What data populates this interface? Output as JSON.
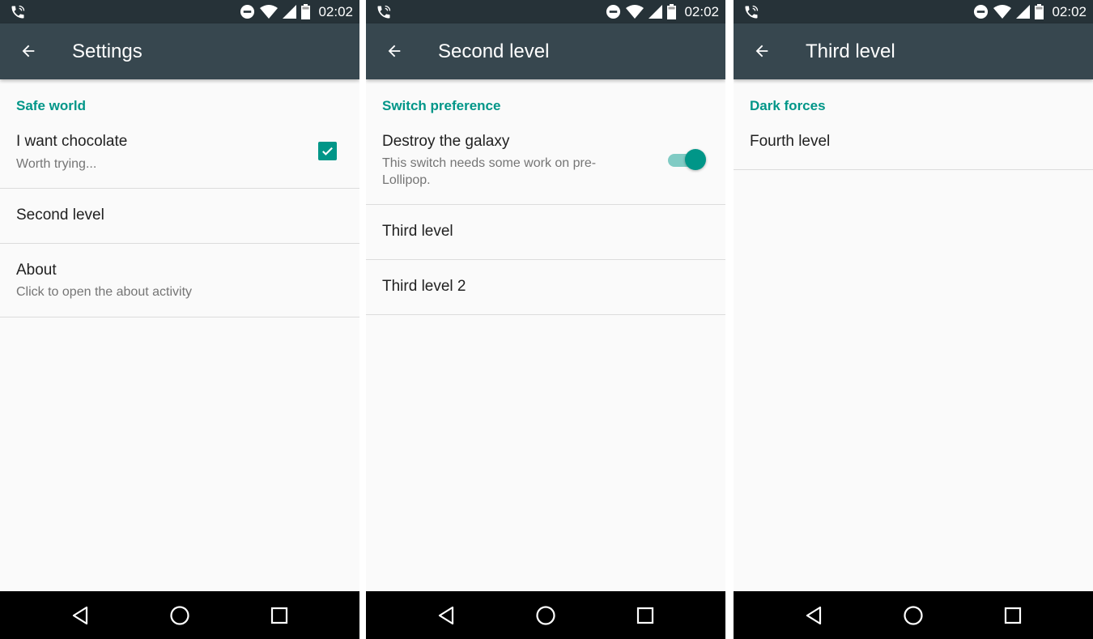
{
  "status_bar": {
    "time": "02:02",
    "icons": [
      "phone-call-icon",
      "do-not-disturb-icon",
      "wifi-icon",
      "cell-signal-icon",
      "battery-icon"
    ]
  },
  "screens": [
    {
      "title": "Settings",
      "category": "Safe world",
      "items": [
        {
          "title": "I want chocolate",
          "summary": "Worth trying...",
          "widget": "checkbox",
          "checked": true
        },
        {
          "title": "Second level"
        },
        {
          "title": "About",
          "summary": "Click to open the about activity"
        }
      ]
    },
    {
      "title": "Second level",
      "category": "Switch preference",
      "items": [
        {
          "title": "Destroy the galaxy",
          "summary": "This switch needs some work on pre-Lollipop.",
          "widget": "switch",
          "on": true
        },
        {
          "title": "Third level"
        },
        {
          "title": "Third level 2"
        }
      ]
    },
    {
      "title": "Third level",
      "category": "Dark forces",
      "items": [
        {
          "title": "Fourth level"
        }
      ]
    }
  ],
  "colors": {
    "accent": "#009688",
    "toolbar": "#37474f",
    "status_bar": "#263238",
    "background": "#fafafa",
    "nav_bar": "#000000"
  }
}
